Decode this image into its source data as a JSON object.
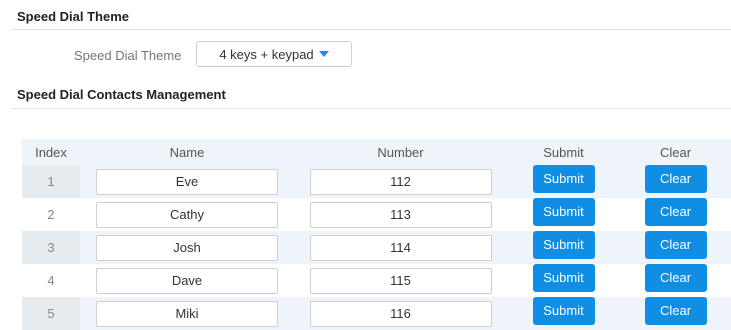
{
  "theme_section": {
    "title": "Speed Dial Theme",
    "field_label": "Speed Dial Theme",
    "selected_value": "4 keys + keypad"
  },
  "contacts_section": {
    "title": "Speed Dial Contacts Management",
    "headers": {
      "index": "Index",
      "name": "Name",
      "number": "Number",
      "submit": "Submit",
      "clear": "Clear"
    },
    "rows": [
      {
        "index": "1",
        "name": "Eve",
        "number": "112",
        "submit_label": "Submit",
        "clear_label": "Clear"
      },
      {
        "index": "2",
        "name": "Cathy",
        "number": "113",
        "submit_label": "Submit",
        "clear_label": "Clear"
      },
      {
        "index": "3",
        "name": "Josh",
        "number": "114",
        "submit_label": "Submit",
        "clear_label": "Clear"
      },
      {
        "index": "4",
        "name": "Dave",
        "number": "115",
        "submit_label": "Submit",
        "clear_label": "Clear"
      },
      {
        "index": "5",
        "name": "Miki",
        "number": "116",
        "submit_label": "Submit",
        "clear_label": "Clear"
      }
    ]
  },
  "colors": {
    "accent": "#0f8ee3",
    "row_stripe": "#eef4fa"
  }
}
